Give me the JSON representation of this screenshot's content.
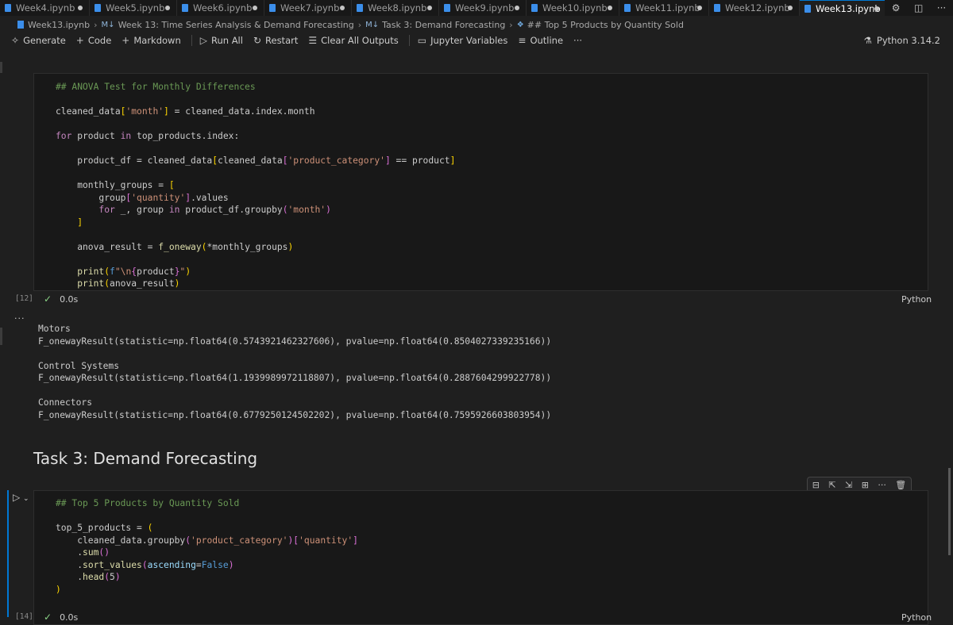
{
  "tabs": [
    {
      "label": "Week4.ipynb"
    },
    {
      "label": "Week5.ipynb"
    },
    {
      "label": "Week6.ipynb"
    },
    {
      "label": "Week7.ipynb"
    },
    {
      "label": "Week8.ipynb"
    },
    {
      "label": "Week9.ipynb"
    },
    {
      "label": "Week10.ipynb"
    },
    {
      "label": "Week11.ipynb"
    },
    {
      "label": "Week12.ipynb"
    },
    {
      "label": "Week13.ipynb"
    }
  ],
  "active_tab": "Week13.ipynb",
  "tab_tools": {
    "settings": "⚙",
    "split": "◫",
    "more": "···"
  },
  "breadcrumb": {
    "file": "Week13.ipynb",
    "md_badge": "M↓",
    "section1": "Week 13: Time Series Analysis & Demand Forecasting",
    "section2": "Task 3: Demand Forecasting",
    "cell": "## Top 5 Products by Quantity Sold"
  },
  "toolbar": {
    "generate": "Generate",
    "code": "Code",
    "markdown": "Markdown",
    "run_all": "Run All",
    "restart": "Restart",
    "clear_outputs": "Clear All Outputs",
    "variables": "Jupyter Variables",
    "outline": "Outline",
    "more": "···",
    "kernel": "Python 3.14.2"
  },
  "cell1": {
    "exec_count": "[12]",
    "duration": "0.0s",
    "language": "Python"
  },
  "output1": {
    "ellipsis": "...",
    "blocks": [
      {
        "name": "Motors",
        "result": "F_onewayResult(statistic=np.float64(0.5743921462327606), pvalue=np.float64(0.8504027339235166))"
      },
      {
        "name": "Control Systems",
        "result": "F_onewayResult(statistic=np.float64(1.1939989972118807), pvalue=np.float64(0.2887604299922778))"
      },
      {
        "name": "Connectors",
        "result": "F_onewayResult(statistic=np.float64(0.6779250124502202), pvalue=np.float64(0.7595926603803954))"
      }
    ]
  },
  "markdown_heading": "Task 3: Demand Forecasting",
  "cell2": {
    "exec_count": "[14]",
    "duration": "0.0s",
    "language": "Python"
  },
  "colors": {
    "accent": "#0078d4",
    "success": "#89d185",
    "background": "#1f1f1f"
  }
}
